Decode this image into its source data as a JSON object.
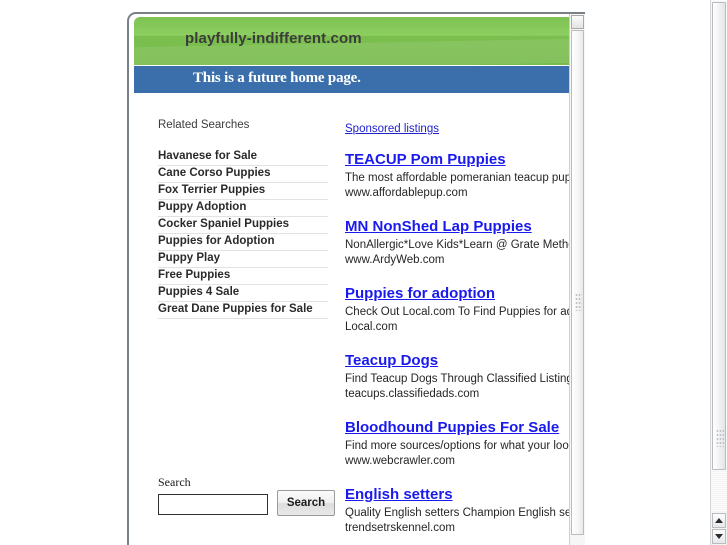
{
  "banner": {
    "site_title": "playfully-indifferent.com",
    "tagline": "This is a future home page.",
    "green_color": "#7ec254",
    "blue_color": "#3a6fab"
  },
  "left_column": {
    "heading": "Related Searches",
    "items": [
      "Havanese for Sale",
      "Cane Corso Puppies",
      "Fox Terrier Puppies",
      "Puppy Adoption",
      "Cocker Spaniel Puppies",
      "Puppies for Adoption",
      "Puppy Play",
      "Free Puppies",
      "Puppies 4 Sale",
      "Great Dane Puppies for Sale"
    ]
  },
  "search": {
    "label": "Search",
    "value": "",
    "placeholder": "",
    "button_label": "Search"
  },
  "sponsored": {
    "heading": "Sponsored listings",
    "link_color": "#1a1aee",
    "ads": [
      {
        "title": "TEACUP Pom Puppies",
        "description": "The most affordable pomeranian teacup puppie",
        "url": "www.affordablepup.com"
      },
      {
        "title": "MN NonShed Lap Puppies",
        "description": "NonAllergic*Love Kids*Learn @ Grate Method",
        "url": "www.ArdyWeb.com"
      },
      {
        "title": "Puppies for adoption",
        "description": "Check Out Local.com To Find Puppies for adop",
        "url": "Local.com"
      },
      {
        "title": "Teacup Dogs",
        "description": "Find Teacup Dogs Through Classified Listings!",
        "url": "teacups.classifiedads.com"
      },
      {
        "title": "Bloodhound Puppies For Sale",
        "description": "Find more sources/options for what your lookin",
        "url": "www.webcrawler.com"
      },
      {
        "title": "English setters",
        "description": "Quality English setters Champion English sette",
        "url": "trendsetrskennel.com"
      }
    ]
  },
  "scrollbars": {
    "outer_name": "page-scrollbar",
    "inner_name": "frame-scrollbar"
  }
}
